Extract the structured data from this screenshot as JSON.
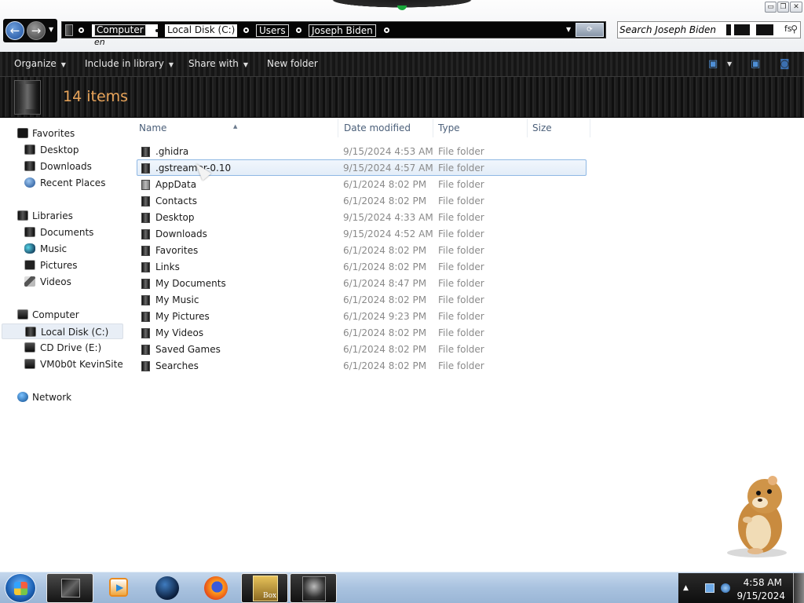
{
  "window": {
    "controls": {
      "minimize": "▭",
      "maximize": "❐",
      "close": "✕"
    }
  },
  "nav": {
    "back_icon": "arrow-left-icon",
    "forward_icon": "arrow-right-icon"
  },
  "breadcrumb": {
    "items": [
      "Computer",
      "Local Disk (C:)",
      "Users",
      "Joseph Biden"
    ],
    "computer_extra": "en"
  },
  "search": {
    "placeholder": "Search Joseph Biden",
    "tail_text": "fs"
  },
  "commandbar": {
    "organize": "Organize",
    "include_in_library": "Include in library",
    "share_with": "Share with",
    "new_folder": "New folder"
  },
  "header": {
    "items_count": "14 items"
  },
  "sidebar": {
    "favorites": {
      "label": "Favorites",
      "items": [
        {
          "label": "Desktop",
          "icon": "desktop-icon"
        },
        {
          "label": "Downloads",
          "icon": "downloads-icon"
        },
        {
          "label": "Recent Places",
          "icon": "recent-places-icon"
        }
      ]
    },
    "libraries": {
      "label": "Libraries",
      "items": [
        {
          "label": "Documents",
          "icon": "documents-icon"
        },
        {
          "label": "Music",
          "icon": "music-icon"
        },
        {
          "label": "Pictures",
          "icon": "pictures-icon"
        },
        {
          "label": "Videos",
          "icon": "videos-icon"
        }
      ]
    },
    "computer": {
      "label": "Computer",
      "items": [
        {
          "label": "Local Disk (C:)",
          "icon": "drive-icon",
          "selected": true
        },
        {
          "label": "CD Drive (E:)",
          "icon": "cd-drive-icon"
        },
        {
          "label": "VM0b0t KevinSite",
          "icon": "network-drive-icon"
        }
      ]
    },
    "network": {
      "label": "Network"
    }
  },
  "filelist": {
    "columns": [
      "Name",
      "Date modified",
      "Type",
      "Size"
    ],
    "rows": [
      {
        "name": ".ghidra",
        "date": "9/15/2024 4:53 AM",
        "type": "File folder"
      },
      {
        "name": ".gstreamer-0.10",
        "date": "9/15/2024 4:57 AM",
        "type": "File folder",
        "selected": true
      },
      {
        "name": "AppData",
        "date": "6/1/2024 8:02 PM",
        "type": "File folder"
      },
      {
        "name": "Contacts",
        "date": "6/1/2024 8:02 PM",
        "type": "File folder"
      },
      {
        "name": "Desktop",
        "date": "9/15/2024 4:33 AM",
        "type": "File folder"
      },
      {
        "name": "Downloads",
        "date": "9/15/2024 4:52 AM",
        "type": "File folder"
      },
      {
        "name": "Favorites",
        "date": "6/1/2024 8:02 PM",
        "type": "File folder"
      },
      {
        "name": "Links",
        "date": "6/1/2024 8:02 PM",
        "type": "File folder"
      },
      {
        "name": "My Documents",
        "date": "6/1/2024 8:47 PM",
        "type": "File folder"
      },
      {
        "name": "My Music",
        "date": "6/1/2024 8:02 PM",
        "type": "File folder"
      },
      {
        "name": "My Pictures",
        "date": "6/1/2024 9:23 PM",
        "type": "File folder"
      },
      {
        "name": "My Videos",
        "date": "6/1/2024 8:02 PM",
        "type": "File folder"
      },
      {
        "name": "Saved Games",
        "date": "6/1/2024 8:02 PM",
        "type": "File folder"
      },
      {
        "name": "Searches",
        "date": "6/1/2024 8:02 PM",
        "type": "File folder"
      }
    ]
  },
  "taskbar": {
    "apps": [
      {
        "name": "explorer-taskbar-button",
        "icon": "explorer-icon"
      },
      {
        "name": "media-player-taskbar-button",
        "icon": "media-player-icon"
      },
      {
        "name": "browser-globe-taskbar-button",
        "icon": "globe-icon"
      },
      {
        "name": "firefox-taskbar-button",
        "icon": "firefox-icon"
      },
      {
        "name": "box-game-taskbar-button",
        "icon": "box-game-icon"
      },
      {
        "name": "app-taskbar-button",
        "icon": "app-icon"
      }
    ],
    "box_label": "Box",
    "clock": {
      "time": "4:58 AM",
      "date": "9/15/2024"
    }
  },
  "colors": {
    "accent_count": "#e8a45a",
    "selection_border": "#8fb8e4",
    "column_header": "#4c607a"
  }
}
